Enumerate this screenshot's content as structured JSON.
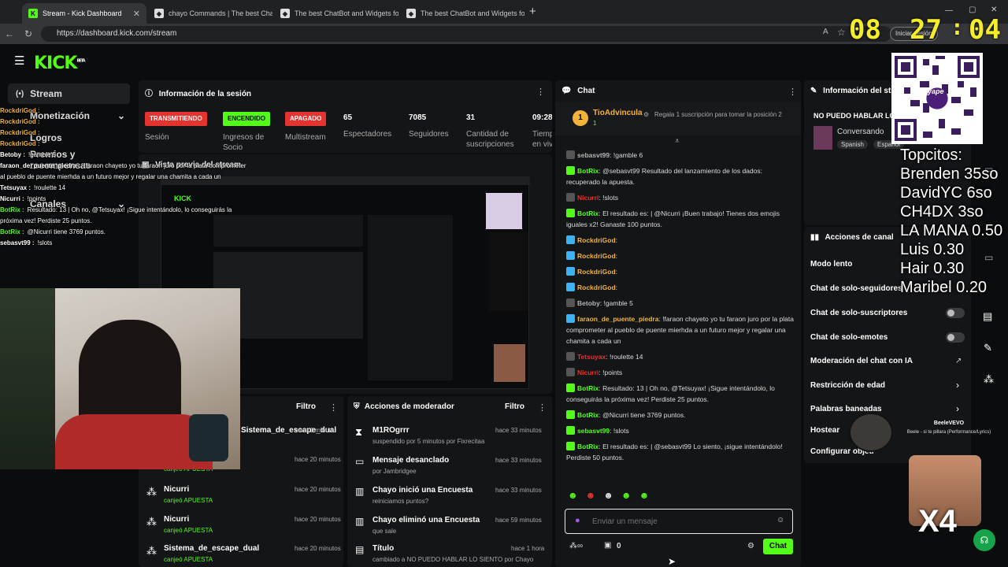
{
  "browser": {
    "tabs": [
      {
        "title": "Stream - Kick Dashboard",
        "active": true
      },
      {
        "title": "chayo Commands | The best Chatb"
      },
      {
        "title": "The best ChatBot and Widgets for"
      },
      {
        "title": "The best ChatBot and Widgets for"
      }
    ],
    "url": "https://dashboard.kick.com/stream",
    "signin_label": "Iniciar sesión"
  },
  "clock": {
    "hh": "08",
    "mm": "27",
    "ss": "04"
  },
  "kick": {
    "logo": "KICK",
    "logo_sup": "BETA"
  },
  "sidebar": {
    "items": [
      {
        "label": "Stream"
      },
      {
        "label": "Monetización"
      },
      {
        "label": "Logros"
      },
      {
        "label": "Premios y recompensas"
      },
      {
        "label": "Canales"
      }
    ]
  },
  "session": {
    "title": "Información de la sesión",
    "statuses": [
      {
        "label": "TRANSMITIENDO",
        "caption": "Sesión"
      },
      {
        "label": "ENCENDIDO",
        "caption": "Ingresos de Socio"
      },
      {
        "label": "APAGADO",
        "caption": "Multistream"
      }
    ],
    "stats": [
      {
        "value": "65",
        "caption": "Espectadores"
      },
      {
        "value": "7085",
        "caption": "Seguidores"
      },
      {
        "value": "31",
        "caption": "Cantidad de suscripciones"
      },
      {
        "value": "09:28",
        "caption": "Tiempo en vivo"
      }
    ]
  },
  "preview": {
    "title": "Vista previa del stream"
  },
  "activity": {
    "filter": "Filtro",
    "items": [
      {
        "name": "Sistema_de_escape_dual",
        "action": "",
        "time": "hace 1 minuto"
      },
      {
        "name": "",
        "action": "canjeó APUESTA",
        "time": "hace 20 minutos"
      },
      {
        "name": "Nicurri",
        "action": "canjeó APUESTA",
        "time": "hace 20 minutos"
      },
      {
        "name": "Nicurri",
        "action": "canjeó APUESTA",
        "time": "hace 20 minutos"
      },
      {
        "name": "Sistema_de_escape_dual",
        "action": "canjeó APUESTA",
        "time": "hace 20 minutos"
      }
    ]
  },
  "modactions": {
    "title": "Acciones de moderador",
    "filter": "Filtro",
    "items": [
      {
        "main": "M1ROgrrr",
        "sub": "suspendido por 5 minutos por Fixrecitaa",
        "time": "hace 33 minutos"
      },
      {
        "main": "Mensaje desanclado",
        "sub": "por Jambridgee",
        "time": "hace 33 minutos"
      },
      {
        "main": "Chayo inició una Encuesta",
        "sub": "reiniciamos puntos?",
        "time": "hace 33 minutos"
      },
      {
        "main": "Chayo eliminó una Encuesta",
        "sub": "que sale",
        "time": "hace 59 minutos"
      },
      {
        "main": "Título",
        "sub": "cambiado a NO PUEDO HABLAR LO SIENTO por Chayo",
        "time": "hace 1 hora"
      }
    ]
  },
  "chat": {
    "title": "Chat",
    "pinned_user": "TioAdvincula",
    "pinned_sub": "1",
    "pinned_text": "Regala 1 suscripción para tomar la posición 2",
    "messages": [
      {
        "user": "sebasvt99",
        "color": "#b4b4b4",
        "text": "!gamble 6"
      },
      {
        "user": "BotRix",
        "color": "#53fc18",
        "text": "@sebasvt99 Resultado del lanzamiento de los dados: recuperado la apuesta."
      },
      {
        "user": "Nicurri",
        "color": "#e3342f",
        "text": "!slots"
      },
      {
        "user": "BotRix",
        "color": "#53fc18",
        "text": "El resultado es: | @Nicurri ¡Buen trabajo! Tienes dos emojis iguales x2! Ganaste 100 puntos."
      },
      {
        "user": "RockdriGod",
        "color": "#f2b33b",
        "text": ""
      },
      {
        "user": "RockdriGod",
        "color": "#f2b33b",
        "text": ""
      },
      {
        "user": "RockdriGod",
        "color": "#f2b33b",
        "text": ""
      },
      {
        "user": "RockdriGod",
        "color": "#f2b33b",
        "text": ""
      },
      {
        "user": "Betoby",
        "color": "#b4b4b4",
        "text": "!gamble 5"
      },
      {
        "user": "faraon_de_puente_piedra",
        "color": "#f2b33b",
        "text": "!faraon chayeto yo tu faraon juro por la plata comprometer al pueblo de puente mierhda a un futuro mejor y regalar una chamita a cada un"
      },
      {
        "user": "Tetsuyax",
        "color": "#e3342f",
        "text": "!roulette 14"
      },
      {
        "user": "Nicurri",
        "color": "#e3342f",
        "text": "!points"
      },
      {
        "user": "BotRix",
        "color": "#53fc18",
        "text": "Resultado: 13 | Oh no, @Tetsuyax! ¡Sigue intentándolo, lo conseguirás la próxima vez! Perdiste 25 puntos."
      },
      {
        "user": "BotRix",
        "color": "#53fc18",
        "text": "@Nicurri tiene 3769 puntos."
      },
      {
        "user": "sebasvt99",
        "color": "#53fc18",
        "text": "!slots"
      },
      {
        "user": "BotRix",
        "color": "#53fc18",
        "text": "El resultado es: | @sebasvt99 Lo siento, ¡sigue intentándolo! Perdiste 50 puntos."
      }
    ],
    "input_placeholder": "Enviar un mensaje",
    "send_label": "Chat",
    "points": "0"
  },
  "streaminfo": {
    "title": "Información del stream",
    "stream_title": "NO PUEDO HABLAR LO SIENTO",
    "category": "Conversando",
    "tags": [
      "Spanish",
      "Español"
    ]
  },
  "channelactions": {
    "title": "Acciones de canal",
    "items": [
      {
        "label": "Modo lento"
      },
      {
        "label": "Chat de solo-seguidores"
      },
      {
        "label": "Chat de solo-suscriptores"
      },
      {
        "label": "Chat de solo-emotes"
      },
      {
        "label": "Moderación del chat con IA"
      },
      {
        "label": "Restricción de edad"
      },
      {
        "label": "Palabras baneadas"
      },
      {
        "label": "Hostear canal"
      },
      {
        "label": "Configurar objetivos"
      }
    ]
  },
  "overlay": {
    "chat": [
      {
        "user": "RockdriGod :",
        "text": ""
      },
      {
        "user": "RockdriGod :",
        "text": ""
      },
      {
        "user": "RockdriGod :",
        "text": ""
      },
      {
        "user": "RockdriGod :",
        "text": ""
      },
      {
        "user": "Betoby :",
        "text": "!gamble 5"
      },
      {
        "user": "faraon_de_puente_piedra :",
        "text": "!faraon chayeto yo tu faraon juro por la plata comprometer al pueblo de puente mierhda a un futuro mejor y regalar una chamita a cada un"
      },
      {
        "user": "Tetsuyax :",
        "text": "!roulette 14"
      },
      {
        "user": "Nicurri :",
        "text": "!points"
      },
      {
        "user": "BotRix :",
        "text": "Resultado: 13 | Oh no, @Tetsuyax! ¡Sigue intentándolo, lo conseguirás la próxima vez! Perdiste 25 puntos."
      },
      {
        "user": "BotRix :",
        "text": "@Nicurri tiene 3769 puntos."
      },
      {
        "user": "sebasvt99 :",
        "text": "!slots"
      }
    ],
    "topcitos_title": "Topcitos:",
    "topcitos": [
      "Brenden 35so",
      "DavidYC 6so",
      "CH4DX 3so",
      "LA MANA 0.50",
      "Luis 0.30",
      "Hair 0.30",
      "Maribel 0.20"
    ],
    "qr_label": "yape",
    "music_artist": "BeeleVEVO",
    "music_title": "Beele - si te pillara (Performance/Lyrics)",
    "x_count": "X4"
  }
}
